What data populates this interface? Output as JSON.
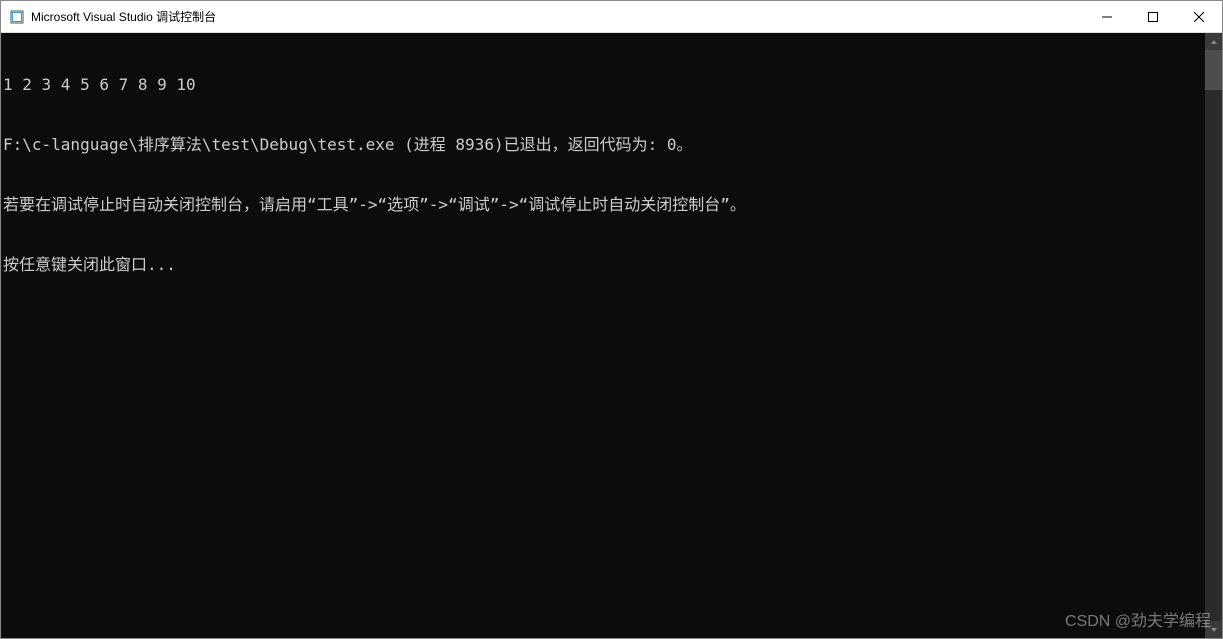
{
  "titlebar": {
    "title": "Microsoft Visual Studio 调试控制台"
  },
  "console": {
    "lines": [
      "1 2 3 4 5 6 7 8 9 10",
      "F:\\c-language\\排序算法\\test\\Debug\\test.exe (进程 8936)已退出，返回代码为: 0。",
      "若要在调试停止时自动关闭控制台，请启用“工具”->“选项”->“调试”->“调试停止时自动关闭控制台”。",
      "按任意键关闭此窗口..."
    ]
  },
  "watermark": "CSDN @劲夫学编程"
}
